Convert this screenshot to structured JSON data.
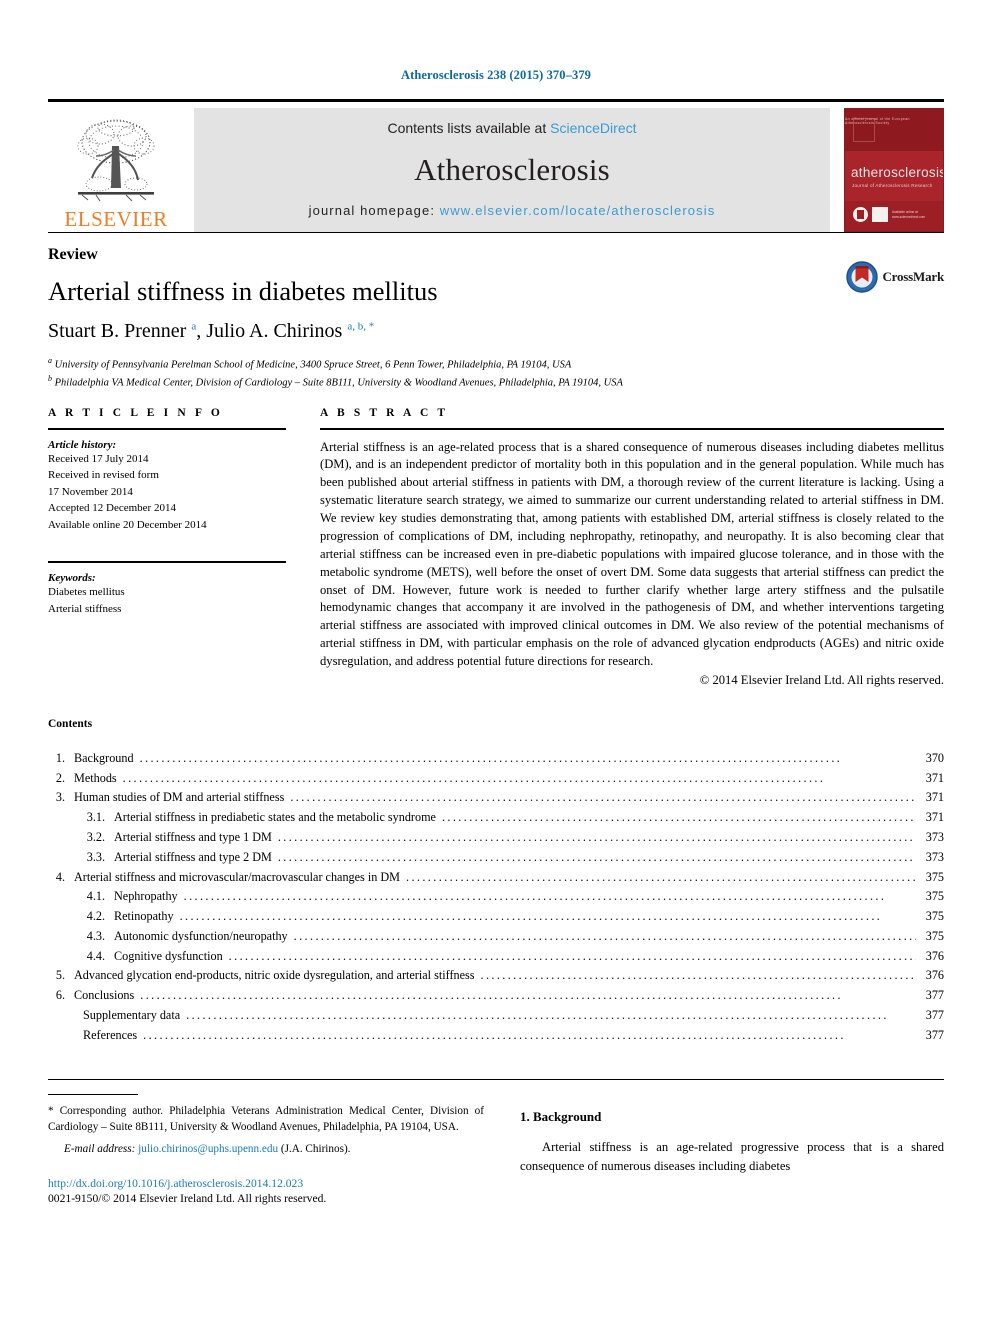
{
  "running_head": "Atherosclerosis 238 (2015) 370–379",
  "masthead": {
    "publisher_name": "ELSEVIER",
    "publisher_logo_icon": "elsevier-tree-icon",
    "contents_lead": "Contents lists available at ",
    "contents_link": "ScienceDirect",
    "journal_name": "Atherosclerosis",
    "homepage_label": "journal homepage: ",
    "homepage_url": "www.elsevier.com/locate/atherosclerosis",
    "cover": {
      "title": "atherosclerosis",
      "subtitle": "Journal of Atherosclerosis Research",
      "topright": "An official journal of the European Atherosclerosis Society",
      "badge_text": "Available online at www.sciencedirect.com"
    }
  },
  "article": {
    "type": "Review",
    "title": "Arterial stiffness in diabetes mellitus",
    "authors_part1": "Stuart B. Prenner ",
    "authors_sup1": "a",
    "authors_part2": ", Julio A. Chirinos ",
    "authors_sup2": "a, b, *",
    "affiliations": [
      {
        "marker": "a",
        "text": "University of Pennsylvania Perelman School of Medicine, 3400 Spruce Street, 6 Penn Tower, Philadelphia, PA 19104, USA"
      },
      {
        "marker": "b",
        "text": "Philadelphia VA Medical Center, Division of Cardiology – Suite 8B111, University & Woodland Avenues, Philadelphia, PA 19104, USA"
      }
    ],
    "crossmark_label": "CrossMark"
  },
  "article_info": {
    "heading": "A R T I C L E  I N F O",
    "history_label": "Article history:",
    "history_lines": [
      "Received 17 July 2014",
      "Received in revised form",
      "17 November 2014",
      "Accepted 12 December 2014",
      "Available online 20 December 2014"
    ],
    "keywords_label": "Keywords:",
    "keywords": [
      "Diabetes mellitus",
      "Arterial stiffness"
    ]
  },
  "abstract": {
    "heading": "A B S T R A C T",
    "text": "Arterial stiffness is an age-related process that is a shared consequence of numerous diseases including diabetes mellitus (DM), and is an independent predictor of mortality both in this population and in the general population. While much has been published about arterial stiffness in patients with DM, a thorough review of the current literature is lacking. Using a systematic literature search strategy, we aimed to summarize our current understanding related to arterial stiffness in DM. We review key studies demonstrating that, among patients with established DM, arterial stiffness is closely related to the progression of complications of DM, including nephropathy, retinopathy, and neuropathy. It is also becoming clear that arterial stiffness can be increased even in pre-diabetic populations with impaired glucose tolerance, and in those with the metabolic syndrome (METS), well before the onset of overt DM. Some data suggests that arterial stiffness can predict the onset of DM. However, future work is needed to further clarify whether large artery stiffness and the pulsatile hemodynamic changes that accompany it are involved in the pathogenesis of DM, and whether interventions targeting arterial stiffness are associated with improved clinical outcomes in DM. We also review of the potential mechanisms of arterial stiffness in DM, with particular emphasis on the role of advanced glycation endproducts (AGEs) and nitric oxide dysregulation, and address potential future directions for research.",
    "copyright": "© 2014 Elsevier Ireland Ltd. All rights reserved."
  },
  "contents": {
    "heading": "Contents",
    "entries": [
      {
        "num": "1.",
        "level": 1,
        "label": "Background",
        "page": "370"
      },
      {
        "num": "2.",
        "level": 1,
        "label": "Methods",
        "page": "371"
      },
      {
        "num": "3.",
        "level": 1,
        "label": "Human studies of DM and arterial stiffness",
        "page": "371"
      },
      {
        "num": "3.1.",
        "level": 2,
        "label": "Arterial stiffness in prediabetic states and the metabolic syndrome",
        "page": "371"
      },
      {
        "num": "3.2.",
        "level": 2,
        "label": "Arterial stiffness and type 1 DM",
        "page": "373"
      },
      {
        "num": "3.3.",
        "level": 2,
        "label": "Arterial stiffness and type 2 DM",
        "page": "373"
      },
      {
        "num": "4.",
        "level": 1,
        "label": "Arterial stiffness and microvascular/macrovascular changes in DM",
        "page": "375"
      },
      {
        "num": "4.1.",
        "level": 2,
        "label": "Nephropathy",
        "page": "375"
      },
      {
        "num": "4.2.",
        "level": 2,
        "label": "Retinopathy",
        "page": "375"
      },
      {
        "num": "4.3.",
        "level": 2,
        "label": "Autonomic dysfunction/neuropathy",
        "page": "375"
      },
      {
        "num": "4.4.",
        "level": 2,
        "label": "Cognitive dysfunction",
        "page": "376"
      },
      {
        "num": "5.",
        "level": 1,
        "label": "Advanced glycation end-products, nitric oxide dysregulation, and arterial stiffness",
        "page": "376"
      },
      {
        "num": "6.",
        "level": 1,
        "label": "Conclusions",
        "page": "377"
      },
      {
        "num": "",
        "level": 3,
        "label": "Supplementary data",
        "page": "377"
      },
      {
        "num": "",
        "level": 3,
        "label": "References",
        "page": "377"
      }
    ]
  },
  "footer": {
    "corresponding_marker": "*",
    "corresponding_text": "Corresponding author. Philadelphia Veterans Administration Medical Center, Division of Cardiology – Suite 8B111, University & Woodland Avenues, Philadelphia, PA 19104, USA.",
    "email_label": "E-mail address:",
    "email": "julio.chirinos@uphs.upenn.edu",
    "email_owner": "(J.A. Chirinos).",
    "doi": "http://dx.doi.org/10.1016/j.atherosclerosis.2014.12.023",
    "issn": "0021-9150/© 2014 Elsevier Ireland Ltd. All rights reserved."
  },
  "section1": {
    "heading": "1.  Background",
    "paragraph": "Arterial stiffness is an age-related progressive process that is a shared consequence of numerous diseases including diabetes"
  },
  "colors": {
    "link_blue": "#1a7bb9",
    "running_head_blue": "#0b6aa2",
    "sd_blue": "#3b9bd0",
    "elsevier_orange": "#ef7d23",
    "cover_red": "#9d1f26",
    "masthead_gray": "#e3e3e3"
  }
}
